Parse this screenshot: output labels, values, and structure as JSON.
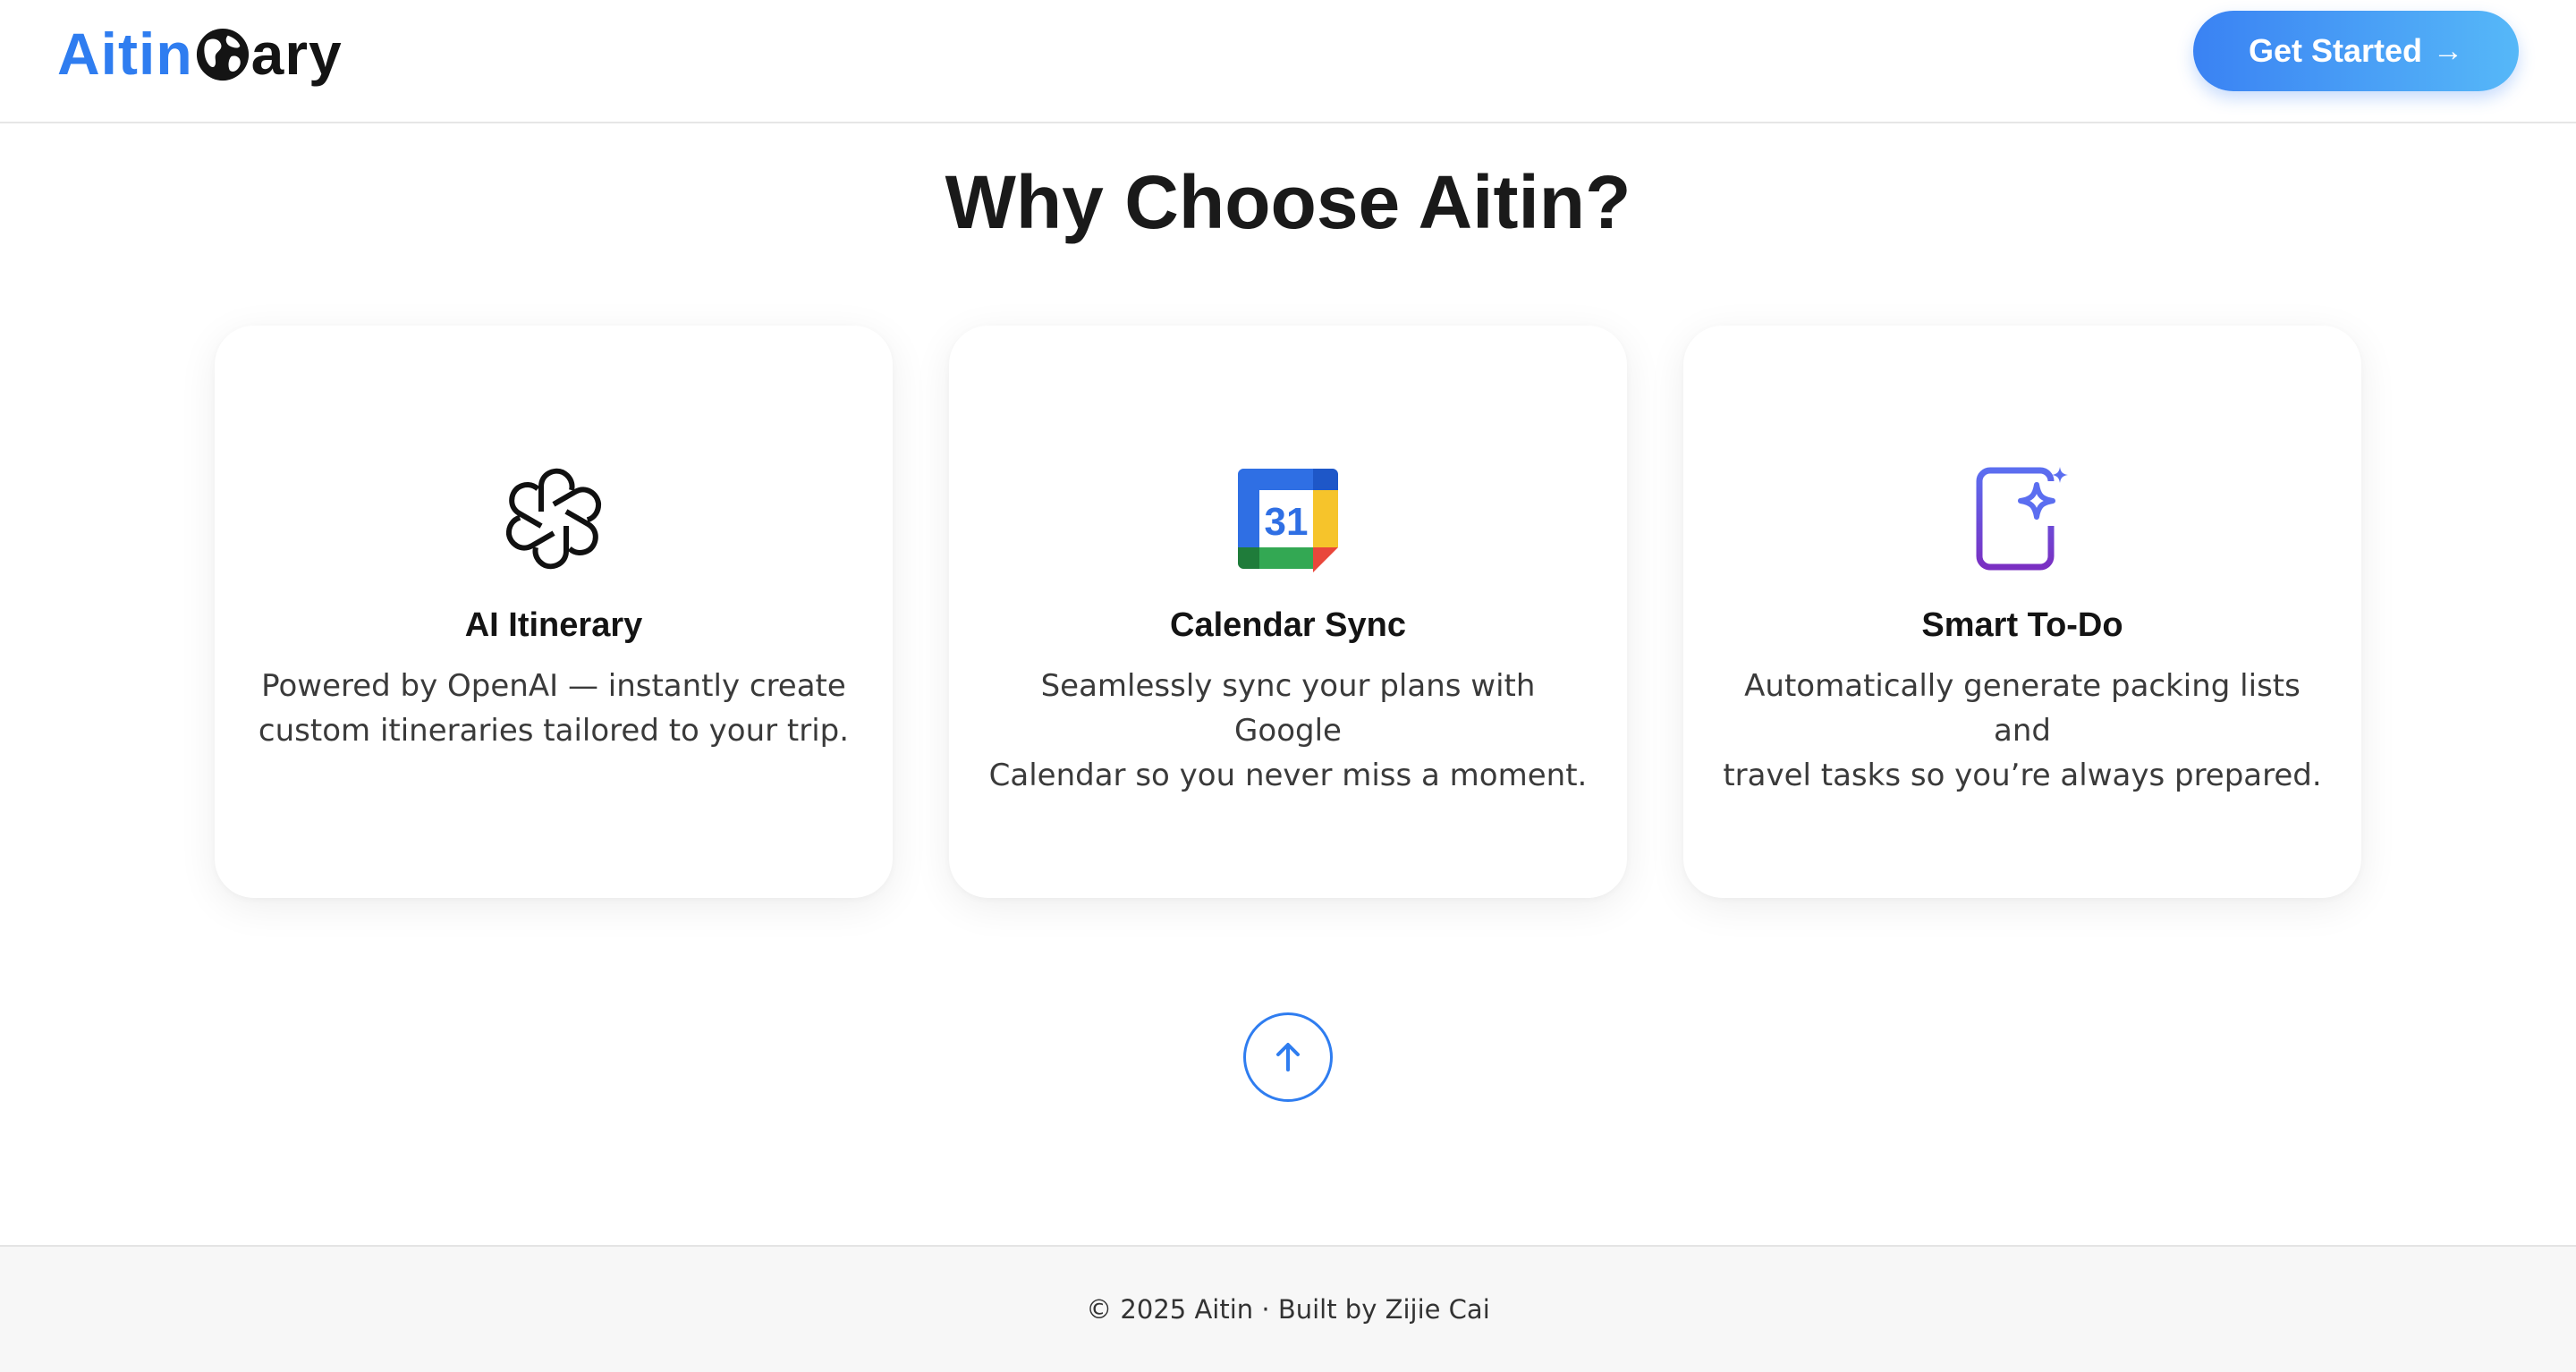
{
  "header": {
    "logo": {
      "part1": "Aitin",
      "globe_icon": "globe-icon",
      "part2": "ary",
      "colors": {
        "part1": "#2f7df0",
        "part2": "#141414"
      }
    },
    "cta": {
      "label": "Get Started",
      "arrow": "→",
      "gradient": [
        "#3a82f3",
        "#56b8f8"
      ]
    }
  },
  "section": {
    "title": "Why Choose Aitin?"
  },
  "features": [
    {
      "icon": "openai-logo-icon",
      "title": "AI Itinerary",
      "line1": "Powered by OpenAI — instantly create",
      "line2": "custom itineraries tailored to your trip."
    },
    {
      "icon": "google-calendar-icon",
      "calendar_day": "31",
      "title": "Calendar Sync",
      "line1": "Seamlessly sync your plans with Google",
      "line2": "Calendar so you never miss a moment."
    },
    {
      "icon": "smart-todo-icon",
      "title": "Smart To-Do",
      "line1": "Automatically generate packing lists and",
      "line2": "travel tasks so you’re always prepared."
    }
  ],
  "scroll_top": {
    "icon": "arrow-up-icon",
    "color": "#2f7df0"
  },
  "footer": {
    "text": "© 2025 Aitin · Built by Zijie Cai"
  }
}
